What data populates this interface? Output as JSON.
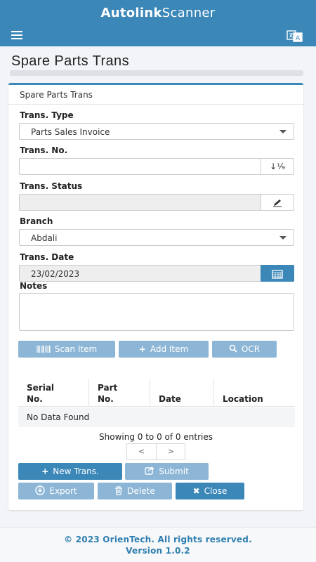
{
  "app": {
    "title_bold": "Autolink",
    "title_rest": "Scanner"
  },
  "page": {
    "title": "Spare Parts Trans"
  },
  "card": {
    "header": "Spare Parts Trans"
  },
  "form": {
    "trans_type": {
      "label": "Trans. Type",
      "value": "Parts Sales Invoice"
    },
    "trans_no": {
      "label": "Trans. No.",
      "value": "",
      "addon": "↓¹⁄₉"
    },
    "trans_status": {
      "label": "Trans. Status",
      "value": ""
    },
    "branch": {
      "label": "Branch",
      "value": "Abdali"
    },
    "trans_date": {
      "label": "Trans. Date",
      "value": "23/02/2023"
    },
    "notes": {
      "label": "Notes",
      "value": ""
    }
  },
  "actions": {
    "scan_item": "Scan Item",
    "add_item": "Add Item",
    "ocr": "OCR"
  },
  "table": {
    "columns": [
      {
        "line1": "Serial",
        "line2": "No."
      },
      {
        "line1": "Part",
        "line2": "No."
      },
      {
        "line1": "",
        "line2": "Date"
      },
      {
        "line1": "",
        "line2": "Location"
      }
    ],
    "empty_text": "No Data Found",
    "showing": "Showing 0 to 0 of 0 entries",
    "prev": "<",
    "next": ">"
  },
  "buttons": {
    "new_trans": "New Trans.",
    "submit": "Submit",
    "export": "Export",
    "delete": "Delete",
    "close": "Close"
  },
  "footer": {
    "copyright": "© 2023 OrienTech. All rights reserved.",
    "version": "Version 1.0.2"
  },
  "colors": {
    "primary": "#3a87b8",
    "primary_light": "#8db6d6",
    "footer_text": "#2e7fb0"
  }
}
